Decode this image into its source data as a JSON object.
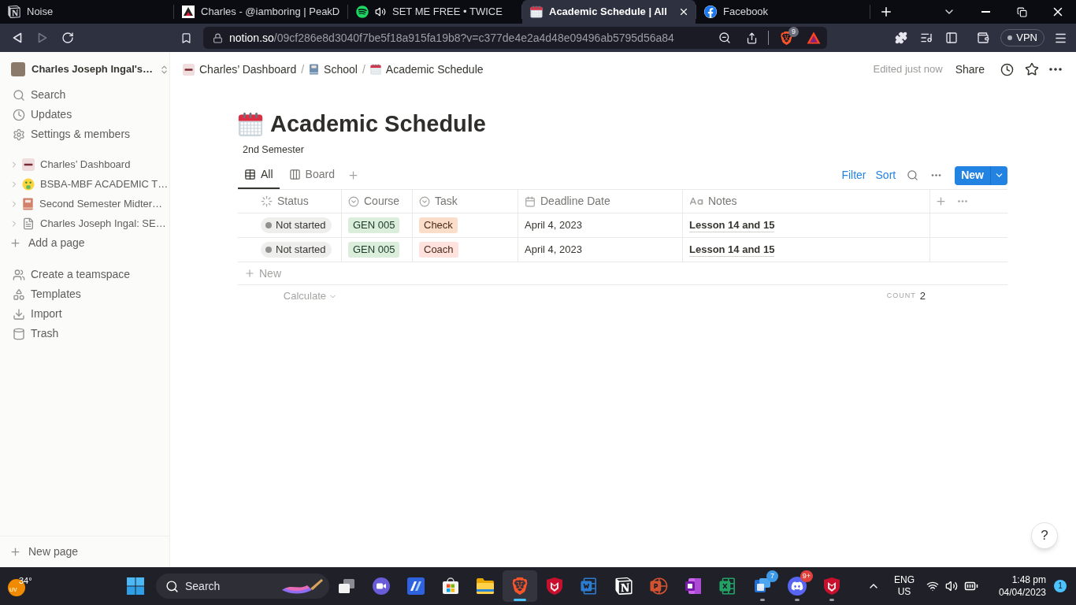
{
  "browser": {
    "tabs": [
      {
        "title": "Noise",
        "selected": false,
        "audio_playing": false
      },
      {
        "title": "Charles - @iamboring | PeakD",
        "selected": false,
        "audio_playing": false
      },
      {
        "title": "SET ME FREE • TWICE",
        "selected": false,
        "audio_playing": true
      },
      {
        "title": "Academic Schedule | All",
        "selected": true,
        "audio_playing": false
      },
      {
        "title": "Facebook",
        "selected": false,
        "audio_playing": false
      }
    ],
    "address": {
      "domain": "notion.so",
      "path": "/09cf286e8d3040f7be5f18a915fa19b8?v=c377de4e2a4d48e09496ab5795d56a84"
    },
    "shields_badge": "9",
    "vpn": "VPN"
  },
  "sidebar": {
    "workspace": "Charles Joseph Ingal's…",
    "menu": [
      "Search",
      "Updates",
      "Settings & members"
    ],
    "pages": [
      "Charles’ Dashboard",
      "BSBA-MBF ACADEMIC T…",
      "Second Semester Midter…",
      "Charles Joseph Ingal: SE…"
    ],
    "add_page": "Add a page",
    "tools": [
      "Create a teamspace",
      "Templates",
      "Import",
      "Trash"
    ],
    "new_page": "New page"
  },
  "topbar": {
    "breadcrumbs": [
      "Charles’ Dashboard",
      "School",
      "Academic Schedule"
    ],
    "separator": "/",
    "edited": "Edited just now",
    "share": "Share"
  },
  "page": {
    "title": "Academic Schedule",
    "description": "2nd Semester",
    "views": [
      {
        "label": "All",
        "selected": true
      },
      {
        "label": "Board",
        "selected": false
      }
    ],
    "actions": {
      "filter": "Filter",
      "sort": "Sort",
      "new": "New"
    },
    "table": {
      "columns": [
        "Status",
        "Course",
        "Task",
        "Deadline Date",
        "Notes"
      ],
      "rows": [
        {
          "status": "Not started",
          "course": {
            "label": "GEN 005",
            "color": "#dbeddb"
          },
          "task": {
            "label": "Check",
            "color": "#fadec9"
          },
          "deadline": "April 4, 2023",
          "notes": "Lesson 14 and 15"
        },
        {
          "status": "Not started",
          "course": {
            "label": "GEN 005",
            "color": "#dbeddb"
          },
          "task": {
            "label": "Coach",
            "color": "#ffe2dd"
          },
          "deadline": "April 4, 2023",
          "notes": "Lesson 14 and 15"
        }
      ],
      "new_row": "New",
      "calculate": "Calculate",
      "count_label": "COUNT",
      "count": "2"
    }
  },
  "help": "?",
  "taskbar": {
    "weather": {
      "temp": "34°",
      "badge": "UV"
    },
    "search": {
      "placeholder": "Search"
    },
    "apps": [
      {
        "selected": false,
        "running": false
      },
      {
        "selected": false,
        "running": false
      },
      {
        "selected": false,
        "running": false
      },
      {
        "selected": false,
        "running": false
      },
      {
        "selected": true,
        "running": true
      },
      {
        "selected": false,
        "running": false
      },
      {
        "selected": false,
        "running": false
      },
      {
        "selected": false,
        "running": false
      },
      {
        "selected": false,
        "running": false
      },
      {
        "selected": false,
        "running": false
      },
      {
        "selected": false,
        "running": false
      },
      {
        "selected": false,
        "running": true,
        "badge": "7"
      },
      {
        "selected": false,
        "running": true,
        "badge": "9+"
      },
      {
        "selected": false,
        "running": true
      }
    ],
    "tray": {
      "language": "ENG",
      "region": "US",
      "time": "1:48 pm",
      "date": "04/04/2023",
      "notifications": "1"
    }
  }
}
